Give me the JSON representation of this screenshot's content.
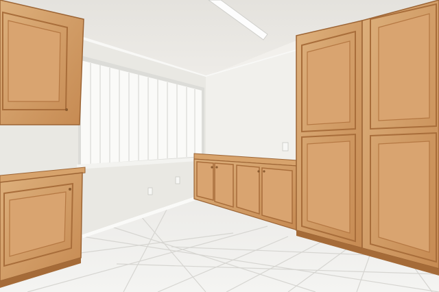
{
  "scene": {
    "kind": "photo",
    "colors": {
      "ceiling": "#e9e7e2",
      "wall_left": "#ecebe6",
      "wall_right": "#f0efeb",
      "floor": "#ededeb",
      "grout": "#d8d7d3",
      "wood_light": "#d9a873",
      "wood_mid": "#c98f58",
      "wood_dark": "#9c6434",
      "light_fixture": "#fbfbfb",
      "window_glass": "#f6f6f4",
      "blinds": "#fafafa",
      "baseboard": "#f7f7f5"
    }
  }
}
